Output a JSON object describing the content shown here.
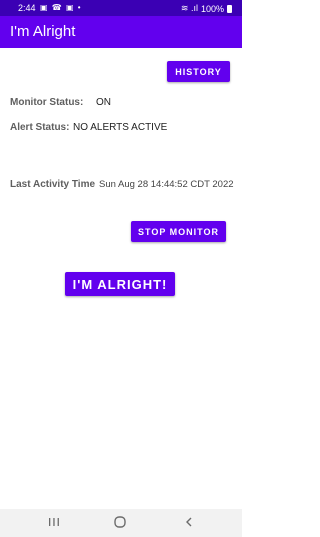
{
  "status_bar": {
    "time": "2:44",
    "notification_icons": "▣ ☎ ▣ •",
    "signal_icons": "≋ .ıl",
    "battery_text": "100%"
  },
  "app": {
    "title": "I'm Alright"
  },
  "buttons": {
    "history": "HISTORY",
    "stop_monitor": "STOP MONITOR",
    "im_alright": "I'M ALRIGHT!"
  },
  "fields": {
    "monitor_status_label": "Monitor Status:",
    "monitor_status_value": "ON",
    "alert_status_label": "Alert Status:",
    "alert_status_value": "NO ALERTS ACTIVE",
    "last_activity_label": "Last Activity Time",
    "last_activity_value": "Sun Aug 28 14:44:52 CDT 2022"
  },
  "nav": {
    "recents_icon": "recents-icon",
    "home_icon": "home-icon",
    "back_icon": "back-icon"
  },
  "colors": {
    "status_bar": "#3b00b4",
    "app_bar": "#6200ee",
    "button": "#6200ee"
  }
}
